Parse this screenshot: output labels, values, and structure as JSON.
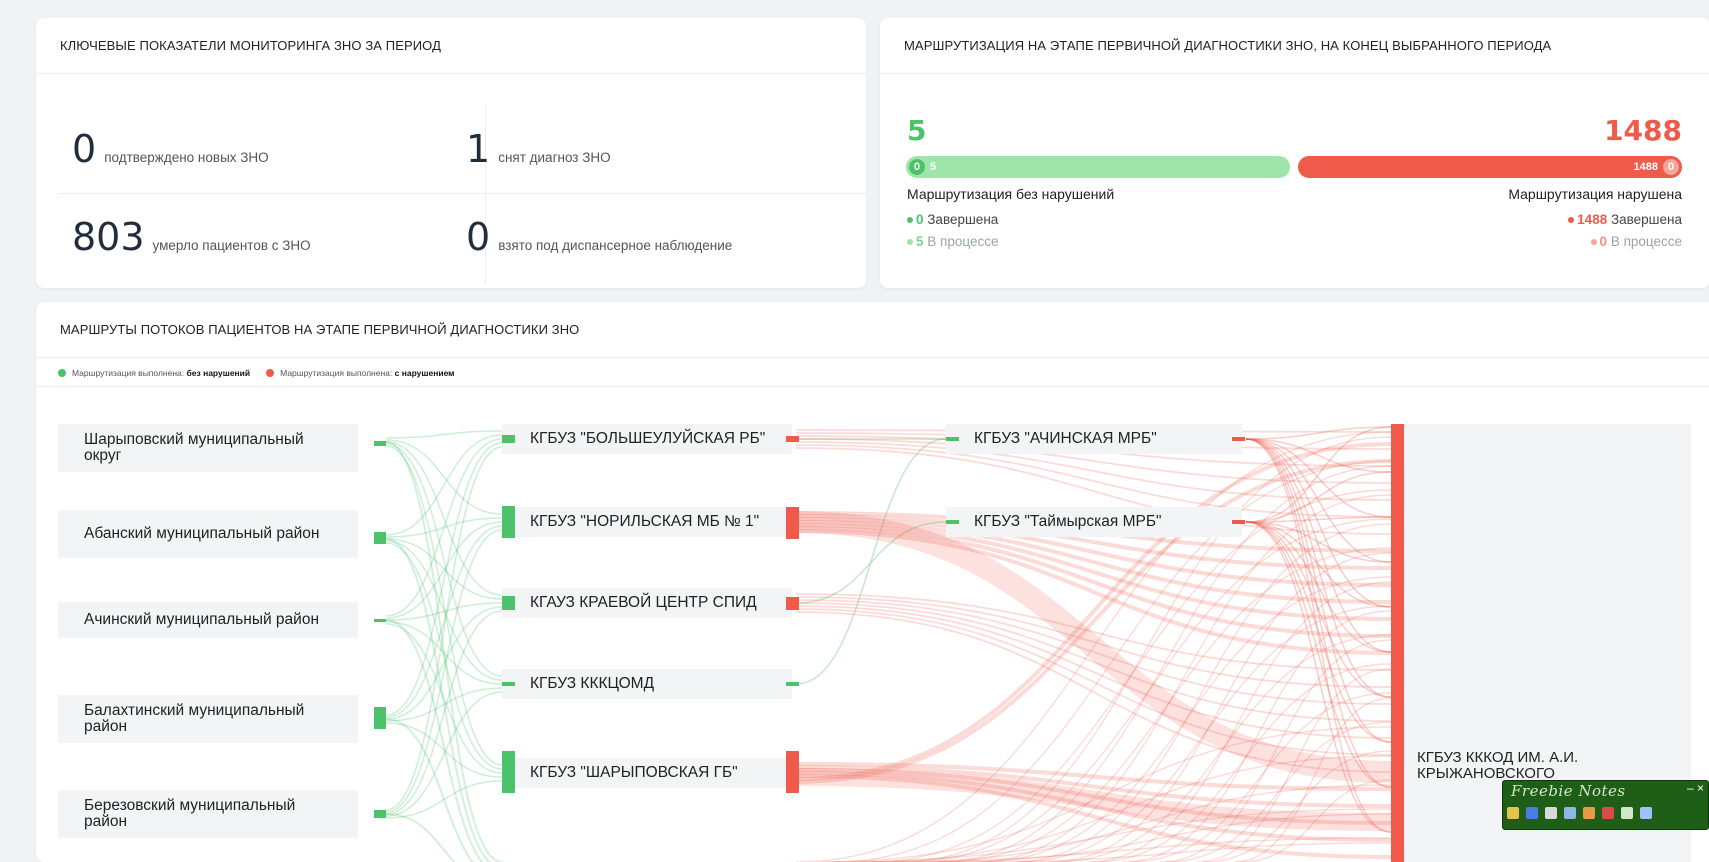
{
  "kpi": {
    "title": "КЛЮЧЕВЫЕ ПОКАЗАТЕЛИ МОНИТОРИНГА ЗНО ЗА ПЕРИОД",
    "items": [
      {
        "value": "0",
        "label": "подтверждено новых ЗНО"
      },
      {
        "value": "1",
        "label": "снят диагноз ЗНО"
      },
      {
        "value": "803",
        "label": "умерло пациентов с ЗНО"
      },
      {
        "value": "0",
        "label": "взято под диспансерное наблюдение"
      }
    ]
  },
  "routing": {
    "title": "МАРШРУТИЗАЦИЯ НА ЭТАПЕ ПЕРВИЧНОЙ ДИАГНОСТИКИ ЗНО, НА КОНЕЦ ВЫБРАННОГО ПЕРИОДА",
    "ok_total": "5",
    "bad_total": "1488",
    "ok_bar_done": "0",
    "ok_bar_progress": "5",
    "bad_bar_done": "1488",
    "bad_bar_progress": "0",
    "ok_label": "Маршрутизация без нарушений",
    "bad_label": "Маршрутизация нарушена",
    "ok_done_value": "0",
    "ok_done_label": "Завершена",
    "ok_progress_value": "5",
    "ok_progress_label": "В процессе",
    "bad_done_value": "1488",
    "bad_done_label": "Завершена",
    "bad_progress_value": "0",
    "bad_progress_label": "В процессе",
    "colors": {
      "green": "#4cc36a",
      "green_light": "#9fe4a8",
      "red": "#ef5a4b"
    }
  },
  "flows": {
    "title": "МАРШРУТЫ ПОТОКОВ ПАЦИЕНТОВ НА ЭТАПЕ ПЕРВИЧНОЙ ДИАГНОСТИКИ ЗНО",
    "legend": {
      "ok_prefix": "Маршрутизация выполнена:",
      "ok_bold": "без нарушений",
      "bad_prefix": "Маршрутизация выполнена:",
      "bad_bold": "с нарушением"
    },
    "sources": [
      {
        "name": "Шарыповский муниципальный",
        "name2": "округ"
      },
      {
        "name": "Абанский муниципальный район",
        "name2": ""
      },
      {
        "name": "Ачинский муниципальный район",
        "name2": ""
      },
      {
        "name": "Балахтинский муниципальный",
        "name2": "район"
      },
      {
        "name": "Березовский муниципальный",
        "name2": "район"
      }
    ],
    "mids": [
      "КГБУЗ \"БОЛЬШЕУЛУЙСКАЯ РБ\"",
      "КГБУЗ \"НОРИЛЬСКАЯ МБ № 1\"",
      "КГАУЗ КРАЕВОЙ ЦЕНТР СПИД",
      "КГБУЗ КККЦОМД",
      "КГБУЗ \"ШАРЫПОВСКАЯ ГБ\""
    ],
    "thirds": [
      "КГБУЗ \"АЧИНСКАЯ МРБ\"",
      "КГБУЗ \"Таймырская МРБ\""
    ],
    "target_line1": "КГБУЗ КККОД ИМ. А.И.",
    "target_line2": "КРЫЖАНОВСКОГО"
  },
  "freebie": {
    "title": "Freebie Notes",
    "close": "– ×"
  }
}
